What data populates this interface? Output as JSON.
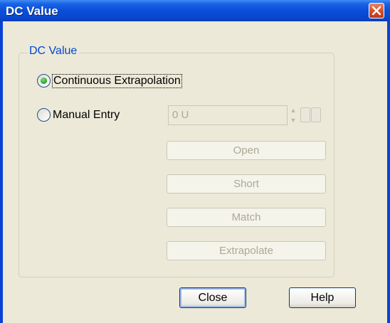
{
  "window": {
    "title": "DC Value"
  },
  "group": {
    "label": "DC Value"
  },
  "options": {
    "continuous_label": "Continuous Extrapolation",
    "continuous_selected": true,
    "manual_label": "Manual Entry",
    "manual_selected": false
  },
  "manual_value": {
    "value": "0 U"
  },
  "action_buttons": {
    "open": "Open",
    "short": "Short",
    "match": "Match",
    "extrapolate": "Extrapolate"
  },
  "footer": {
    "close_label": "Close",
    "help_label": "Help"
  },
  "icons": {
    "close": "close-icon",
    "spin_up": "spin-up-icon",
    "spin_down": "spin-down-icon"
  },
  "colors": {
    "title_bar": "#0a4fd9",
    "group_label": "#0046d5",
    "radio_selected": "#21a121",
    "disabled_text": "#aca899"
  }
}
